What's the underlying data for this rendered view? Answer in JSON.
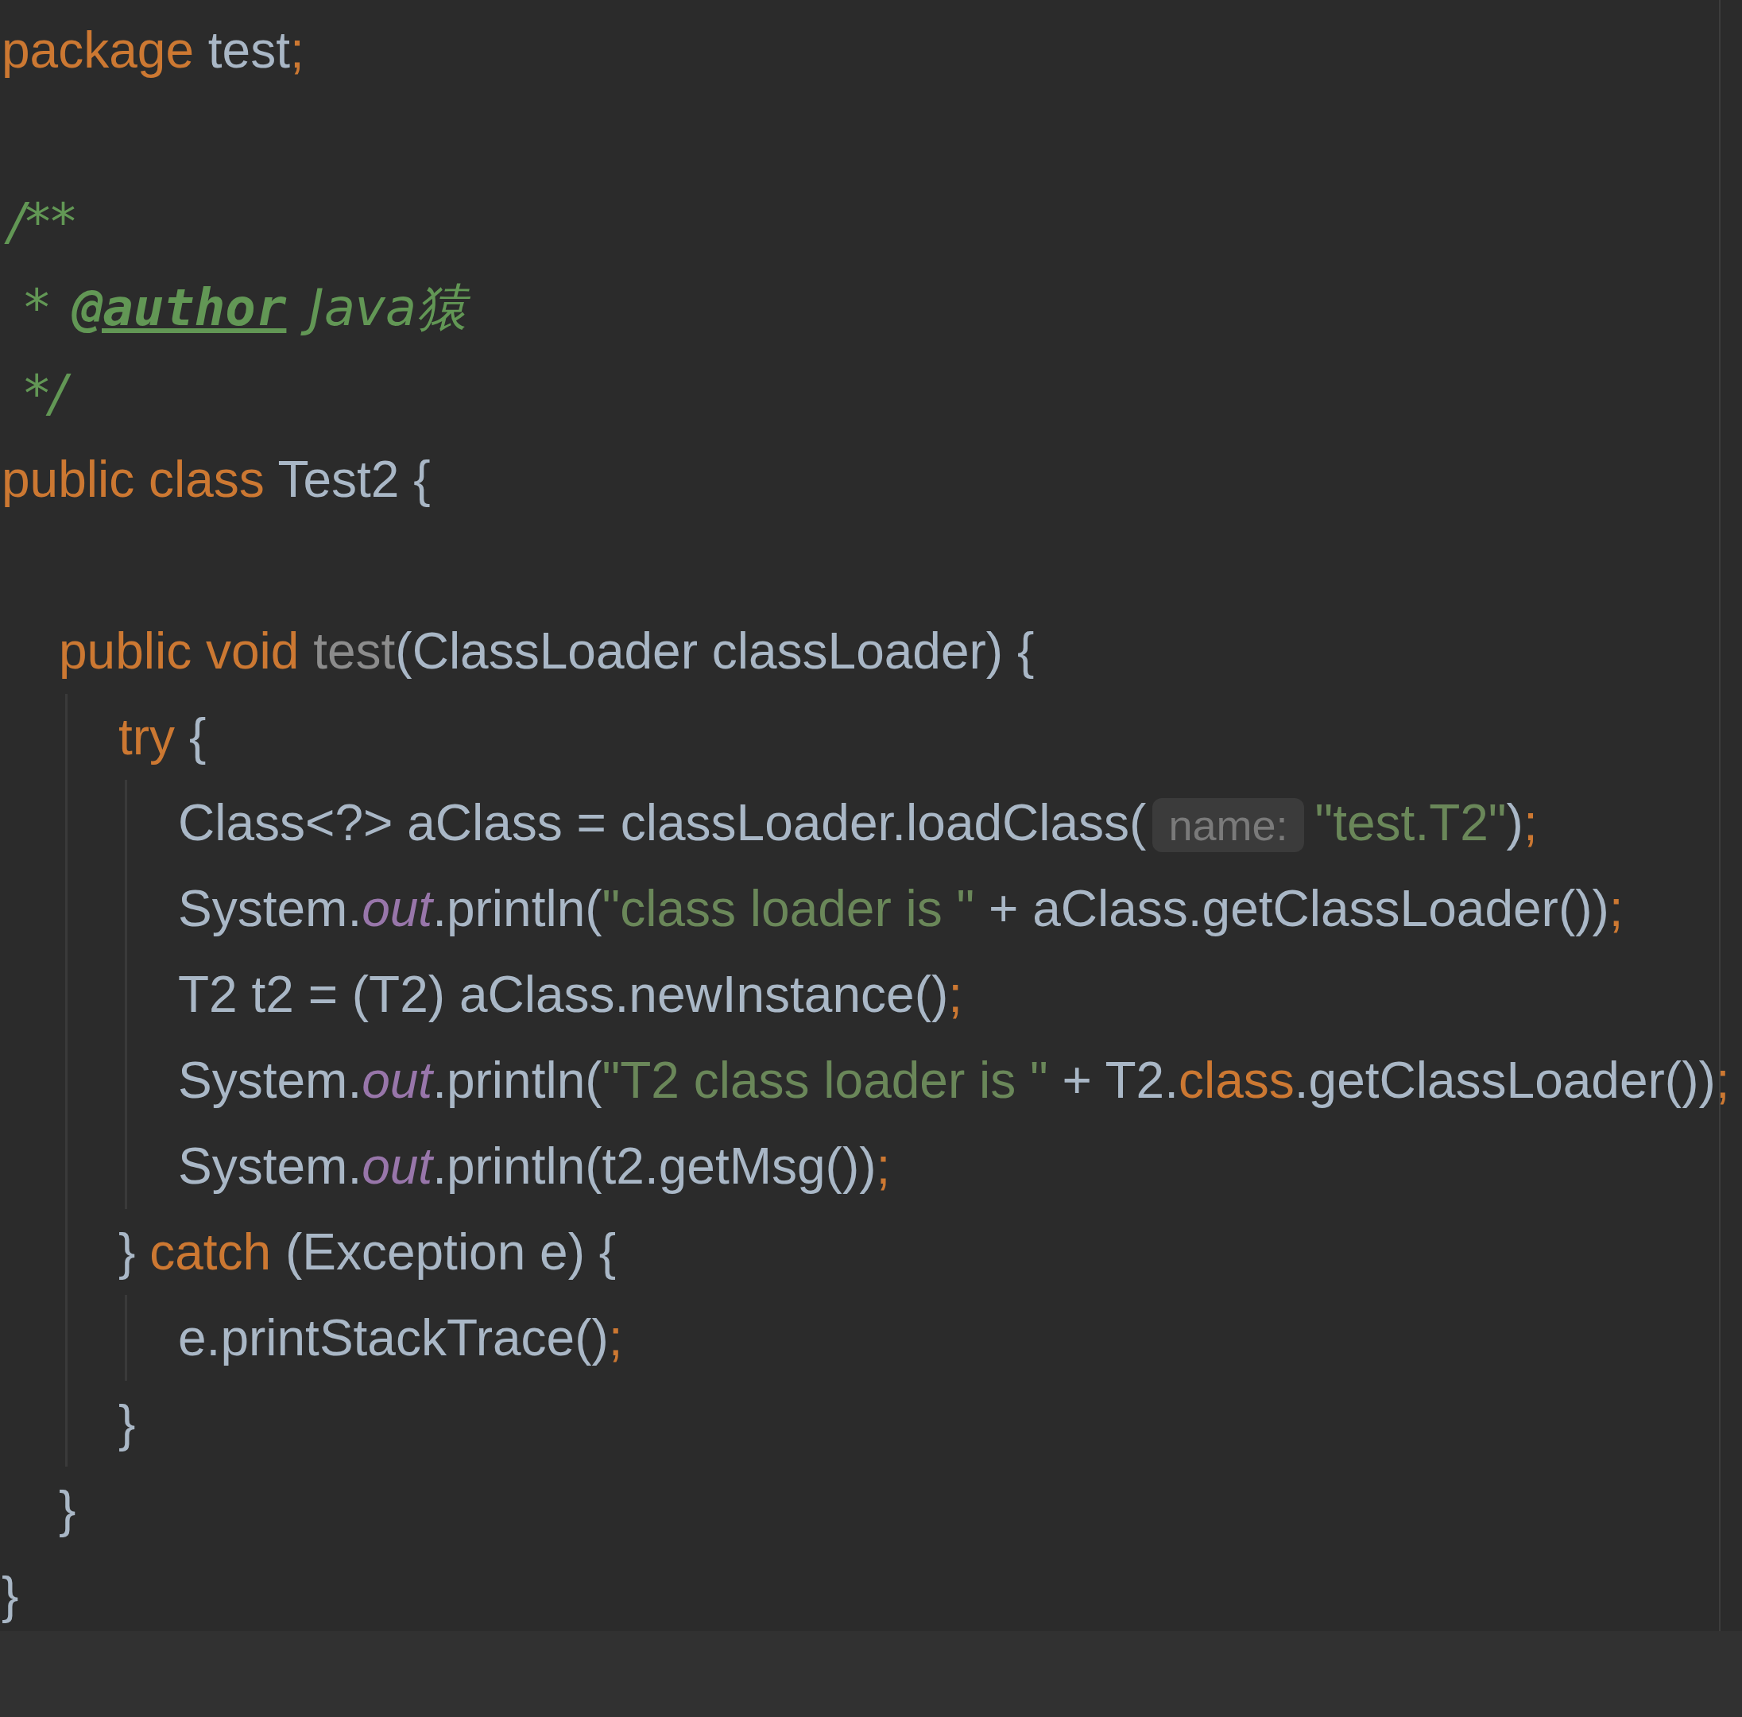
{
  "editor": {
    "lines": [
      {
        "kind": "code",
        "tokens": [
          {
            "kind": "keyword",
            "text": "package "
          },
          {
            "kind": "plain",
            "text": "test"
          },
          {
            "kind": "keyword",
            "text": ";"
          }
        ]
      },
      {
        "kind": "blank"
      },
      {
        "kind": "code",
        "tokens": [
          {
            "kind": "comment",
            "text": "/**"
          }
        ]
      },
      {
        "kind": "code",
        "tokens": [
          {
            "kind": "comment",
            "text": " * "
          },
          {
            "kind": "doctag",
            "text": "@author"
          },
          {
            "kind": "comment",
            "text": " Java猿"
          }
        ]
      },
      {
        "kind": "code",
        "tokens": [
          {
            "kind": "comment",
            "text": " */"
          }
        ]
      },
      {
        "kind": "code",
        "tokens": [
          {
            "kind": "keyword",
            "text": "public class "
          },
          {
            "kind": "plain",
            "text": "Test2 {"
          }
        ],
        "children": [
          {
            "kind": "blank"
          },
          {
            "kind": "code",
            "tokens": [
              {
                "kind": "keyword",
                "text": "public void "
              },
              {
                "kind": "unused",
                "text": "test"
              },
              {
                "kind": "plain",
                "text": "(ClassLoader classLoader) {"
              }
            ],
            "children": [
              {
                "kind": "code",
                "tokens": [
                  {
                    "kind": "keyword",
                    "text": "try "
                  },
                  {
                    "kind": "plain",
                    "text": "{"
                  }
                ],
                "children": [
                  {
                    "kind": "code",
                    "tokens": [
                      {
                        "kind": "plain",
                        "text": "Class<?> aClass = classLoader.loadClass("
                      },
                      {
                        "kind": "hint",
                        "text": "name:"
                      },
                      {
                        "kind": "string",
                        "text": "\"test.T2\""
                      },
                      {
                        "kind": "plain",
                        "text": ")"
                      },
                      {
                        "kind": "keyword",
                        "text": ";"
                      }
                    ]
                  },
                  {
                    "kind": "code",
                    "tokens": [
                      {
                        "kind": "plain",
                        "text": "System."
                      },
                      {
                        "kind": "field",
                        "text": "out"
                      },
                      {
                        "kind": "plain",
                        "text": ".println("
                      },
                      {
                        "kind": "string",
                        "text": "\"class loader is \""
                      },
                      {
                        "kind": "plain",
                        "text": " + aClass.getClassLoader())"
                      },
                      {
                        "kind": "keyword",
                        "text": ";"
                      }
                    ]
                  },
                  {
                    "kind": "code",
                    "tokens": [
                      {
                        "kind": "plain",
                        "text": "T2 t2 = (T2) aClass.newInstance()"
                      },
                      {
                        "kind": "keyword",
                        "text": ";"
                      }
                    ]
                  },
                  {
                    "kind": "code",
                    "tokens": [
                      {
                        "kind": "plain",
                        "text": "System."
                      },
                      {
                        "kind": "field",
                        "text": "out"
                      },
                      {
                        "kind": "plain",
                        "text": ".println("
                      },
                      {
                        "kind": "string",
                        "text": "\"T2 class loader is \""
                      },
                      {
                        "kind": "plain",
                        "text": " + T2."
                      },
                      {
                        "kind": "keyword",
                        "text": "class"
                      },
                      {
                        "kind": "plain",
                        "text": ".getClassLoader())"
                      },
                      {
                        "kind": "keyword",
                        "text": ";"
                      }
                    ]
                  },
                  {
                    "kind": "code",
                    "tokens": [
                      {
                        "kind": "plain",
                        "text": "System."
                      },
                      {
                        "kind": "field",
                        "text": "out"
                      },
                      {
                        "kind": "plain",
                        "text": ".println(t2.getMsg())"
                      },
                      {
                        "kind": "keyword",
                        "text": ";"
                      }
                    ]
                  }
                ]
              },
              {
                "kind": "code",
                "tokens": [
                  {
                    "kind": "plain",
                    "text": "} "
                  },
                  {
                    "kind": "keyword",
                    "text": "catch "
                  },
                  {
                    "kind": "plain",
                    "text": "(Exception e) {"
                  }
                ],
                "children": [
                  {
                    "kind": "code",
                    "tokens": [
                      {
                        "kind": "plain",
                        "text": "e.printStackTrace()"
                      },
                      {
                        "kind": "keyword",
                        "text": ";"
                      }
                    ]
                  }
                ]
              },
              {
                "kind": "code",
                "tokens": [
                  {
                    "kind": "plain",
                    "text": "}"
                  }
                ]
              }
            ]
          },
          {
            "kind": "code",
            "tokens": [
              {
                "kind": "plain",
                "text": "}"
              }
            ]
          }
        ]
      },
      {
        "kind": "code",
        "tokens": [
          {
            "kind": "plain",
            "text": "}"
          }
        ]
      }
    ]
  }
}
